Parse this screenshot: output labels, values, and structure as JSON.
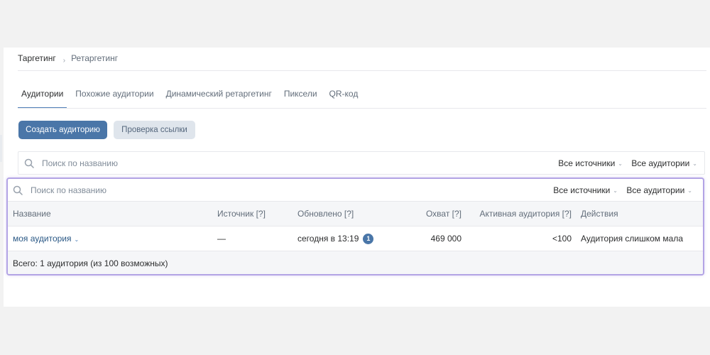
{
  "breadcrumb": {
    "items": [
      "Таргетинг",
      "Ретаргетинг"
    ],
    "separator": "›"
  },
  "tabs": [
    {
      "label": "Аудитории",
      "active": true
    },
    {
      "label": "Похожие аудитории",
      "active": false
    },
    {
      "label": "Динамический ретаргетинг",
      "active": false
    },
    {
      "label": "Пиксели",
      "active": false
    },
    {
      "label": "QR-код",
      "active": false
    }
  ],
  "buttons": {
    "create": "Создать аудиторию",
    "check_link": "Проверка ссылки"
  },
  "filter": {
    "search_placeholder": "Поиск по названию",
    "sources": "Все источники",
    "audiences": "Все аудитории"
  },
  "table": {
    "headers": {
      "name": "Название",
      "source": "Источник [?]",
      "updated": "Обновлено [?]",
      "reach": "Охват [?]",
      "active": "Активная аудитория [?]",
      "actions": "Действия"
    },
    "rows": [
      {
        "name": "моя аудитория",
        "source": "—",
        "updated": "сегодня в 13:19",
        "updated_badge": "1",
        "reach": "469 000",
        "active": "<100",
        "actions": "Аудитория слишком мала"
      }
    ],
    "footer": "Всего: 1 аудитория (из 100 возможных)"
  },
  "colors": {
    "accent": "#4a76a8",
    "link": "#2a5885",
    "highlight_border": "#b3a4e5"
  },
  "icons": {
    "search": "search-icon",
    "chevron": "chevron-down-icon"
  }
}
